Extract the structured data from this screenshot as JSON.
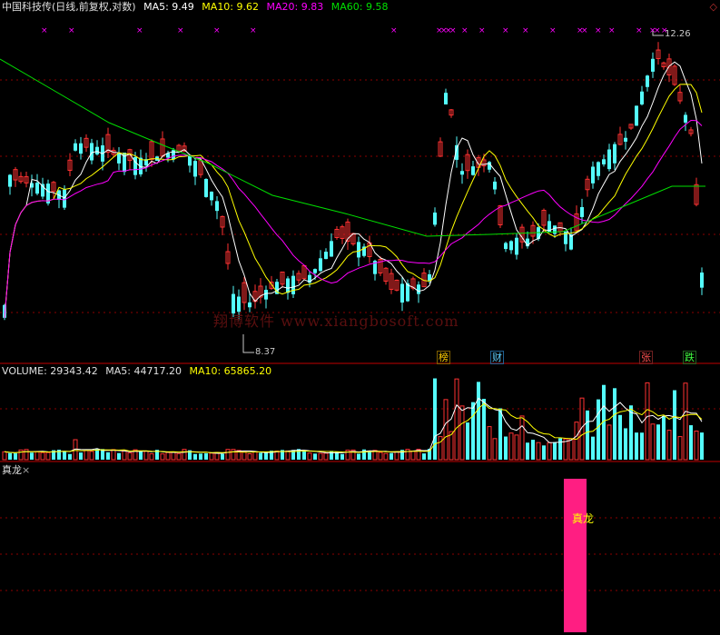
{
  "panel_top": {
    "security": "中国科技传(日线,前复权,对数)",
    "ma5": "MA5: 9.49",
    "ma10": "MA10: 9.62",
    "ma20": "MA20: 9.83",
    "ma60": "MA60: 9.58",
    "high_label": "12.26",
    "low_label": "8.37",
    "corner_icon": "◇",
    "watermark": "翔博软件 www.xiangbosoft.com",
    "tags": [
      "榜",
      "财",
      "张",
      "跌"
    ]
  },
  "panel_volume": {
    "volume": "VOLUME: 29343.42",
    "ma5": "MA5: 44717.20",
    "ma10": "MA10: 65865.20"
  },
  "panel_indicator": {
    "name": "真龙",
    "close_icon": "×",
    "signal_label": "真龙"
  },
  "colors": {
    "up": "#ff3232",
    "down": "#54fcfc",
    "ma5": "#ffffff",
    "ma10": "#ffff00",
    "ma20": "#ff00ff",
    "ma60": "#00e000",
    "signal": "#ff1e82",
    "grid": "#8b0000"
  },
  "chart_data": [
    {
      "type": "candlestick",
      "title": "中国科技传(日线,前复权,对数)",
      "scale": "log",
      "ylim": [
        8.0,
        12.6
      ],
      "annotations": {
        "high": 12.26,
        "low": 8.37
      },
      "series": [
        "MA5",
        "MA10",
        "MA20",
        "MA60"
      ]
    },
    {
      "type": "bar",
      "title": "VOLUME",
      "last_volume": 29343.42,
      "ma5": 44717.2,
      "ma10": 65865.2
    },
    {
      "type": "bar",
      "title": "真龙",
      "signal_count": 1
    }
  ]
}
